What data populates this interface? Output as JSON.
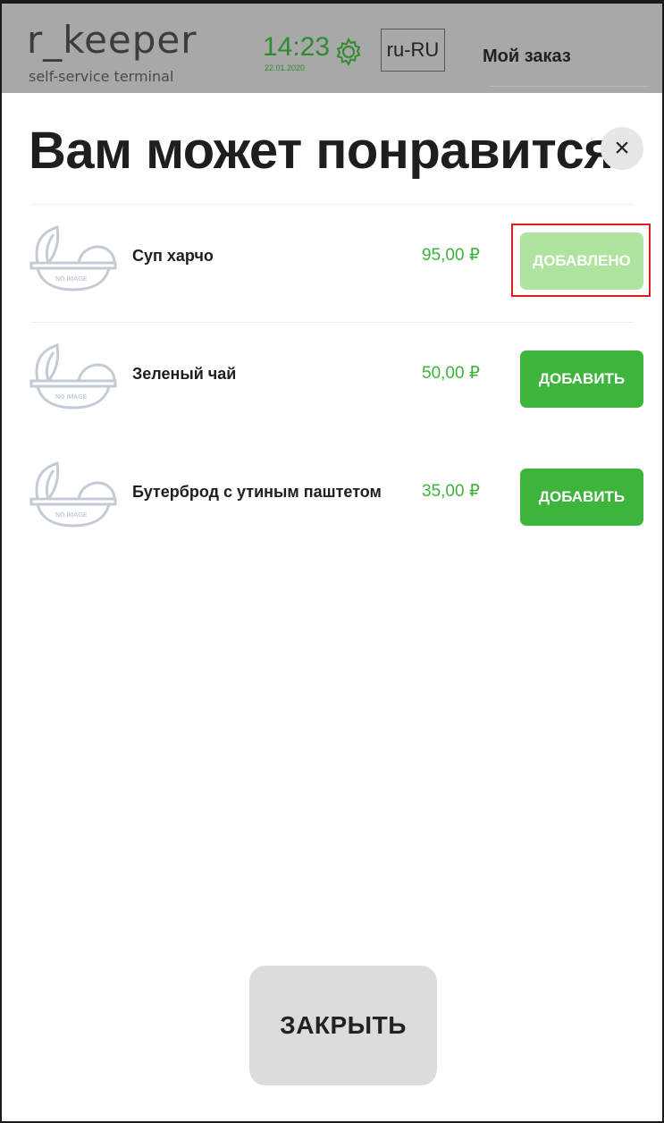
{
  "header": {
    "logo_main": "r_keeper",
    "logo_sub": "self-service terminal",
    "time": "14:23",
    "date": "22.01.2020",
    "settings_icon": "gear-icon",
    "language": "ru-RU",
    "order_label": "Мой заказ"
  },
  "dialog": {
    "title": "Вам может понравится",
    "close_icon": "×"
  },
  "items": [
    {
      "name": "Суп харчо",
      "price": "95,00 ₽",
      "button": "ДОБАВЛЕНО",
      "state": "added",
      "image_label": "NO IMAGE"
    },
    {
      "name": "Зеленый чай",
      "price": "50,00 ₽",
      "button": "ДОБАВИТЬ",
      "state": "default",
      "image_label": "NO IMAGE"
    },
    {
      "name": "Бутерброд с утиным паштетом",
      "price": "35,00 ₽",
      "button": "ДОБАВИТЬ",
      "state": "default",
      "image_label": "NO IMAGE"
    }
  ],
  "footer": {
    "close_label": "ЗАКРЫТЬ"
  },
  "colors": {
    "header_bg": "#a8a8a8",
    "accent_green": "#3db53d",
    "added_green": "#aee4a0",
    "price_green": "#3cb43c",
    "highlight_red": "#e01c1c"
  }
}
